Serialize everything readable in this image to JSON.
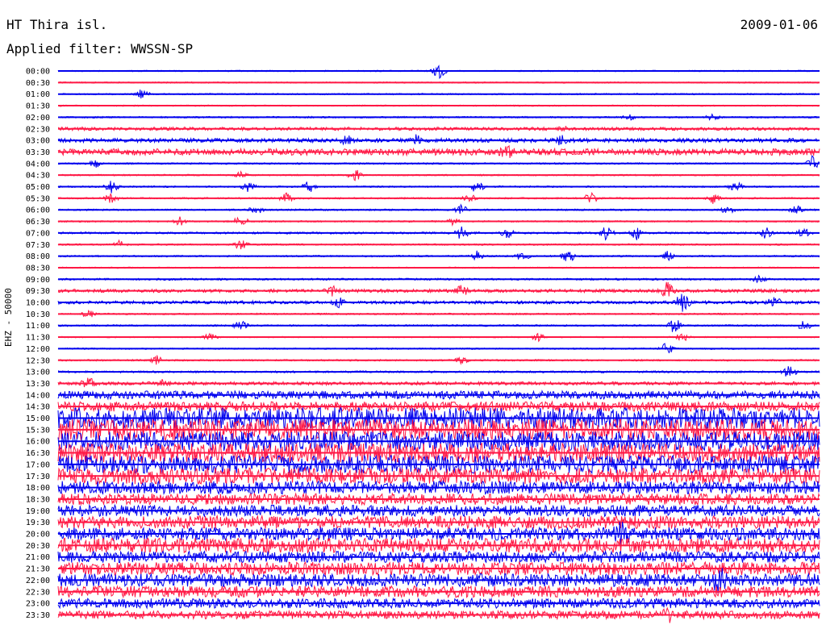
{
  "header": {
    "station": "HT Thira isl.",
    "date": "2009-01-06",
    "filter": "Applied filter: WWSSN-SP"
  },
  "chart_data": {
    "type": "line",
    "title": "HT Thira isl.",
    "subtitle": "Applied filter: WWSSN-SP",
    "date": "2009-01-06",
    "ylabel": "EHZ - 50000",
    "xlabel": "",
    "colors": [
      "#0000ee",
      "#ff1744"
    ],
    "traces": [
      {
        "label": "00:00",
        "color": "#0000ee",
        "noise": 0.8,
        "events": [
          [
            0.5,
            12
          ]
        ]
      },
      {
        "label": "00:30",
        "color": "#ff1744",
        "noise": 0.8,
        "events": []
      },
      {
        "label": "01:00",
        "color": "#0000ee",
        "noise": 0.9,
        "events": [
          [
            0.11,
            6
          ]
        ]
      },
      {
        "label": "01:30",
        "color": "#ff1744",
        "noise": 0.8,
        "events": []
      },
      {
        "label": "02:00",
        "color": "#0000ee",
        "noise": 1.0,
        "events": [
          [
            0.75,
            3
          ],
          [
            0.86,
            4
          ]
        ]
      },
      {
        "label": "02:30",
        "color": "#ff1744",
        "noise": 2.0,
        "events": [
          [
            0.66,
            3
          ]
        ]
      },
      {
        "label": "03:00",
        "color": "#0000ee",
        "noise": 2.5,
        "events": [
          [
            0.47,
            7
          ],
          [
            0.66,
            8
          ],
          [
            0.38,
            5
          ]
        ]
      },
      {
        "label": "03:30",
        "color": "#ff1744",
        "noise": 4.0,
        "events": [
          [
            0.59,
            5
          ]
        ]
      },
      {
        "label": "04:00",
        "color": "#0000ee",
        "noise": 1.0,
        "events": [
          [
            0.05,
            5
          ],
          [
            0.99,
            9
          ]
        ]
      },
      {
        "label": "04:30",
        "color": "#ff1744",
        "noise": 0.9,
        "events": [
          [
            0.39,
            8
          ],
          [
            0.24,
            4
          ]
        ]
      },
      {
        "label": "05:00",
        "color": "#0000ee",
        "noise": 1.0,
        "events": [
          [
            0.07,
            8
          ],
          [
            0.25,
            6
          ],
          [
            0.33,
            7
          ],
          [
            0.55,
            8
          ],
          [
            0.89,
            6
          ]
        ]
      },
      {
        "label": "05:30",
        "color": "#ff1744",
        "noise": 1.0,
        "events": [
          [
            0.07,
            6
          ],
          [
            0.3,
            6
          ],
          [
            0.54,
            5
          ],
          [
            0.7,
            7
          ],
          [
            0.86,
            6
          ]
        ]
      },
      {
        "label": "06:00",
        "color": "#0000ee",
        "noise": 1.0,
        "events": [
          [
            0.26,
            6
          ],
          [
            0.53,
            6
          ],
          [
            0.88,
            5
          ],
          [
            0.97,
            6
          ]
        ]
      },
      {
        "label": "06:30",
        "color": "#ff1744",
        "noise": 1.0,
        "events": [
          [
            0.16,
            5
          ],
          [
            0.24,
            7
          ],
          [
            0.52,
            5
          ]
        ]
      },
      {
        "label": "07:00",
        "color": "#0000ee",
        "noise": 1.2,
        "events": [
          [
            0.53,
            8
          ],
          [
            0.59,
            6
          ],
          [
            0.72,
            8
          ],
          [
            0.76,
            8
          ],
          [
            0.93,
            7
          ],
          [
            0.98,
            6
          ]
        ]
      },
      {
        "label": "07:30",
        "color": "#ff1744",
        "noise": 1.0,
        "events": [
          [
            0.08,
            5
          ],
          [
            0.24,
            7
          ]
        ]
      },
      {
        "label": "08:00",
        "color": "#0000ee",
        "noise": 1.0,
        "events": [
          [
            0.55,
            6
          ],
          [
            0.61,
            7
          ],
          [
            0.67,
            8
          ],
          [
            0.8,
            6
          ]
        ]
      },
      {
        "label": "08:30",
        "color": "#ff1744",
        "noise": 0.8,
        "events": []
      },
      {
        "label": "09:00",
        "color": "#0000ee",
        "noise": 1.2,
        "events": [
          [
            0.92,
            4
          ]
        ]
      },
      {
        "label": "09:30",
        "color": "#ff1744",
        "noise": 2.0,
        "events": [
          [
            0.36,
            5
          ],
          [
            0.53,
            6
          ],
          [
            0.8,
            10
          ]
        ]
      },
      {
        "label": "10:00",
        "color": "#0000ee",
        "noise": 2.0,
        "events": [
          [
            0.37,
            6
          ],
          [
            0.82,
            12
          ],
          [
            0.94,
            7
          ]
        ]
      },
      {
        "label": "10:30",
        "color": "#ff1744",
        "noise": 1.0,
        "events": [
          [
            0.04,
            5
          ]
        ]
      },
      {
        "label": "11:00",
        "color": "#0000ee",
        "noise": 1.0,
        "events": [
          [
            0.24,
            6
          ],
          [
            0.81,
            10
          ],
          [
            0.98,
            6
          ]
        ]
      },
      {
        "label": "11:30",
        "color": "#ff1744",
        "noise": 0.8,
        "events": [
          [
            0.2,
            5
          ],
          [
            0.63,
            5
          ],
          [
            0.82,
            6
          ]
        ]
      },
      {
        "label": "12:00",
        "color": "#0000ee",
        "noise": 0.9,
        "events": [
          [
            0.8,
            8
          ]
        ]
      },
      {
        "label": "12:30",
        "color": "#ff1744",
        "noise": 1.0,
        "events": [
          [
            0.13,
            6
          ],
          [
            0.53,
            4
          ]
        ]
      },
      {
        "label": "13:00",
        "color": "#0000ee",
        "noise": 1.2,
        "events": [
          [
            0.96,
            8
          ]
        ]
      },
      {
        "label": "13:30",
        "color": "#ff1744",
        "noise": 2.0,
        "events": [
          [
            0.04,
            6
          ],
          [
            0.14,
            5
          ]
        ]
      },
      {
        "label": "14:00",
        "color": "#0000ee",
        "noise": 5.0,
        "events": []
      },
      {
        "label": "14:30",
        "color": "#ff1744",
        "noise": 6.0,
        "events": []
      },
      {
        "label": "15:00",
        "color": "#0000ee",
        "noise": 13.0,
        "events": []
      },
      {
        "label": "15:30",
        "color": "#ff1744",
        "noise": 13.0,
        "events": []
      },
      {
        "label": "16:00",
        "color": "#0000ee",
        "noise": 12.0,
        "events": []
      },
      {
        "label": "16:30",
        "color": "#ff1744",
        "noise": 12.0,
        "events": []
      },
      {
        "label": "17:00",
        "color": "#0000ee",
        "noise": 11.0,
        "events": []
      },
      {
        "label": "17:30",
        "color": "#ff1744",
        "noise": 10.0,
        "events": []
      },
      {
        "label": "18:00",
        "color": "#0000ee",
        "noise": 8.0,
        "events": []
      },
      {
        "label": "18:30",
        "color": "#ff1744",
        "noise": 7.0,
        "events": []
      },
      {
        "label": "19:00",
        "color": "#0000ee",
        "noise": 7.0,
        "events": []
      },
      {
        "label": "19:30",
        "color": "#ff1744",
        "noise": 8.0,
        "events": []
      },
      {
        "label": "20:00",
        "color": "#0000ee",
        "noise": 8.0,
        "events": [
          [
            0.74,
            10
          ]
        ]
      },
      {
        "label": "20:30",
        "color": "#ff1744",
        "noise": 9.0,
        "events": []
      },
      {
        "label": "21:00",
        "color": "#0000ee",
        "noise": 7.0,
        "events": []
      },
      {
        "label": "21:30",
        "color": "#ff1744",
        "noise": 8.0,
        "events": []
      },
      {
        "label": "22:00",
        "color": "#0000ee",
        "noise": 8.0,
        "events": [
          [
            0.87,
            14
          ]
        ]
      },
      {
        "label": "22:30",
        "color": "#ff1744",
        "noise": 7.0,
        "events": []
      },
      {
        "label": "23:00",
        "color": "#0000ee",
        "noise": 6.0,
        "events": []
      },
      {
        "label": "23:30",
        "color": "#ff1744",
        "noise": 5.0,
        "events": [
          [
            0.8,
            7
          ]
        ]
      }
    ]
  }
}
